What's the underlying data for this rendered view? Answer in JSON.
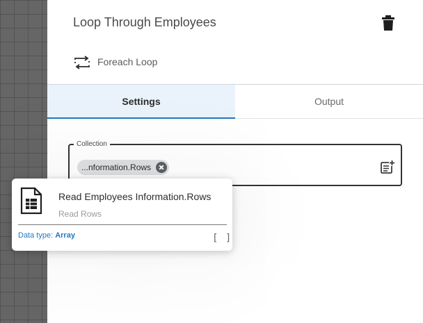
{
  "panel": {
    "title": "Loop Through Employees",
    "loop_type": "Foreach Loop"
  },
  "tabs": [
    {
      "label": "Settings",
      "active": true
    },
    {
      "label": "Output",
      "active": false
    }
  ],
  "collection": {
    "label": "Collection",
    "chip_text": "...nformation.Rows"
  },
  "popup": {
    "title": "Read Employees Information.Rows",
    "subtitle": "Read Rows",
    "data_type_label": "Data type:",
    "data_type_value": "Array",
    "array_glyph": "[ ]"
  },
  "icons": {
    "delete": "trash-icon",
    "loop": "loop-icon",
    "chip_remove": "close-circle-icon",
    "add": "add-list-icon",
    "document": "spreadsheet-document-icon"
  },
  "colors": {
    "accent": "#1f78c1",
    "active_tab_bg": "#eaf3fb",
    "canvas": "#666666"
  }
}
